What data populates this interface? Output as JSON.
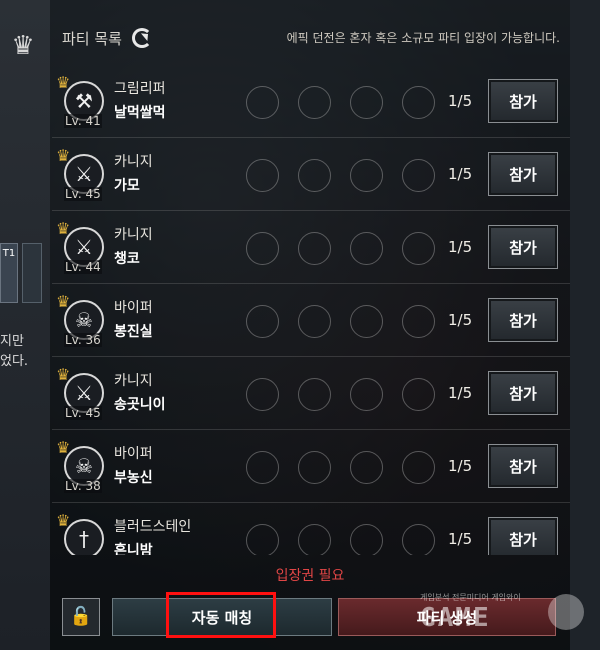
{
  "header": {
    "title": "파티 목록",
    "note": "에픽 던전은 혼자 혹은 소규모 파티 입장이 가능합니다."
  },
  "left": {
    "badge": "T1",
    "text_1": "지만",
    "text_2": "었다."
  },
  "parties": [
    {
      "job": "그림리퍼",
      "name": "날먹쌀먹",
      "level": "Lv. 41",
      "count": "1/5",
      "join": "참가",
      "icon": "scythe-icon"
    },
    {
      "job": "카니지",
      "name": "가모",
      "level": "Lv. 45",
      "count": "1/5",
      "join": "참가",
      "icon": "pistol-icon"
    },
    {
      "job": "카니지",
      "name": "챙코",
      "level": "Lv. 44",
      "count": "1/5",
      "join": "참가",
      "icon": "pistol-icon"
    },
    {
      "job": "바이퍼",
      "name": "봉진실",
      "level": "Lv. 36",
      "count": "1/5",
      "join": "참가",
      "icon": "skull-icon"
    },
    {
      "job": "카니지",
      "name": "송곳니이",
      "level": "Lv. 45",
      "count": "1/5",
      "join": "참가",
      "icon": "pistol-icon"
    },
    {
      "job": "바이퍼",
      "name": "부농신",
      "level": "Lv. 38",
      "count": "1/5",
      "join": "참가",
      "icon": "skull-icon"
    },
    {
      "job": "블러드스테인",
      "name": "흔니밤",
      "level": "",
      "count": "1/5",
      "join": "참가",
      "icon": "sword-icon"
    }
  ],
  "ticket_required": "입장권 필요",
  "bottom": {
    "auto_match": "자동 매칭",
    "create_party": "파티 생성"
  },
  "watermark": {
    "logo": "GAME",
    "sub": "게임분석 전문미디어 게임와이"
  },
  "colors": {
    "crown": "#e0b23c",
    "warning": "#e04646",
    "highlight": "#ff1010"
  }
}
